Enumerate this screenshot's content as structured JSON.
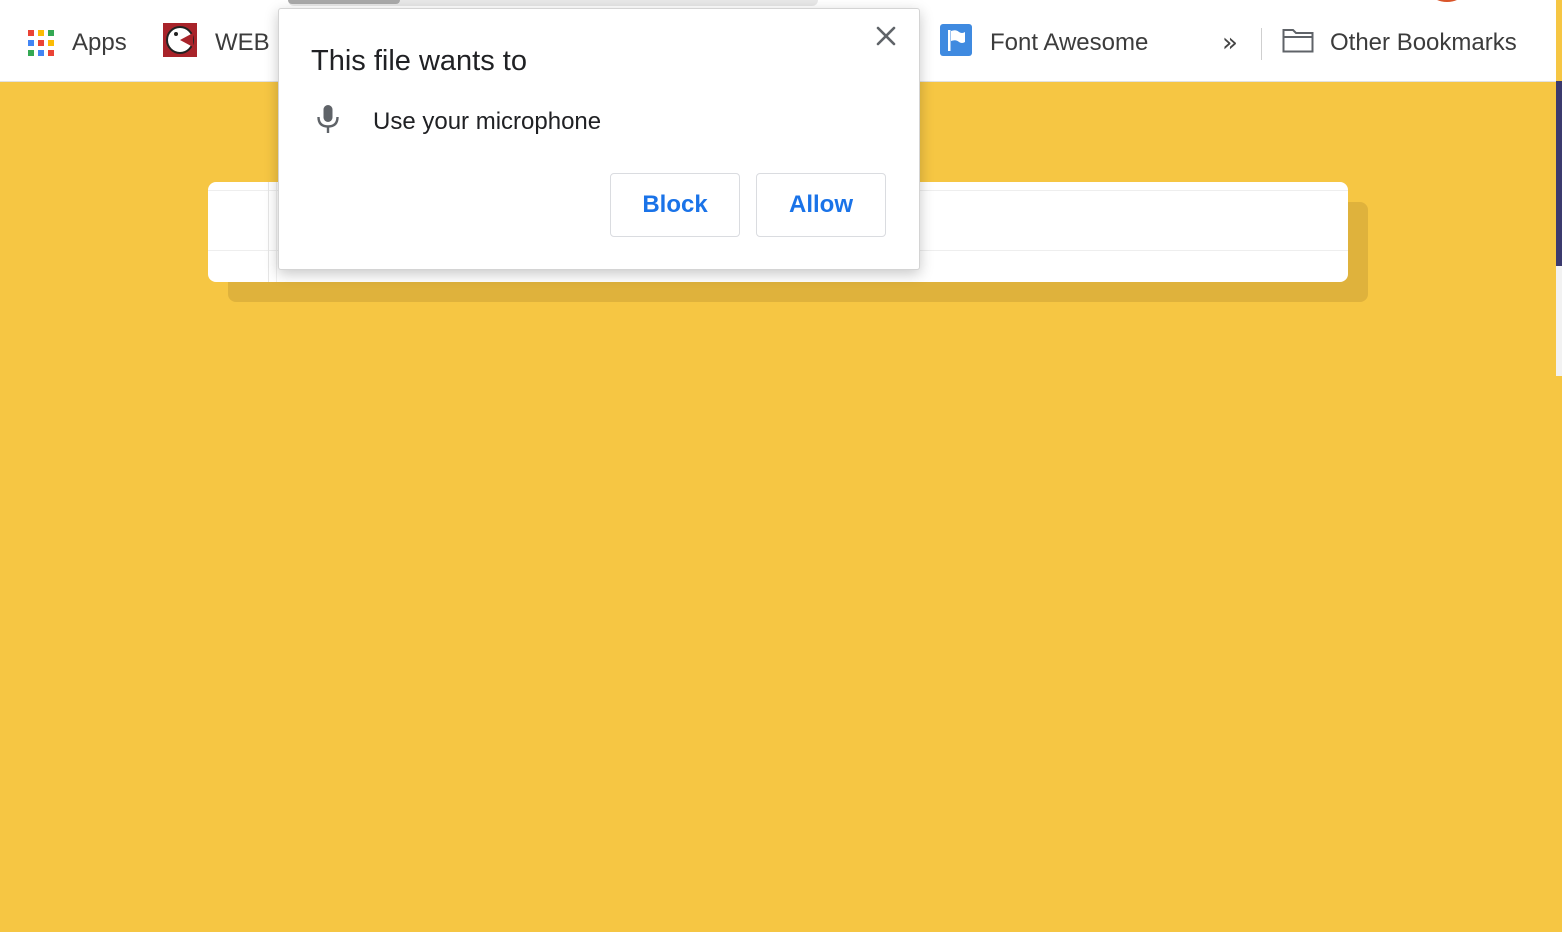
{
  "bookmarks_bar": {
    "items": [
      {
        "label": "Apps",
        "icon": "apps-grid-icon"
      },
      {
        "label": "WEB F",
        "icon": "site-favicon-icon"
      },
      {
        "label": "Font Awesome",
        "icon": "flag-favicon-icon"
      }
    ],
    "overflow_chevron": "»",
    "other_bookmarks": {
      "label": "Other Bookmarks",
      "icon": "folder-icon"
    }
  },
  "permission_popup": {
    "title": "This file wants to",
    "permission": {
      "icon": "microphone-icon",
      "label": "Use your microphone"
    },
    "close_icon": "close-icon",
    "buttons": {
      "block": "Block",
      "allow": "Allow"
    }
  },
  "colors": {
    "page_background": "#f6c643",
    "button_text": "#1a73e8",
    "apps_dots": [
      "#ea4335",
      "#fbbc05",
      "#34a853",
      "#4285f4",
      "#ea4335",
      "#fbbc05",
      "#34a853",
      "#4285f4",
      "#ea4335"
    ]
  }
}
